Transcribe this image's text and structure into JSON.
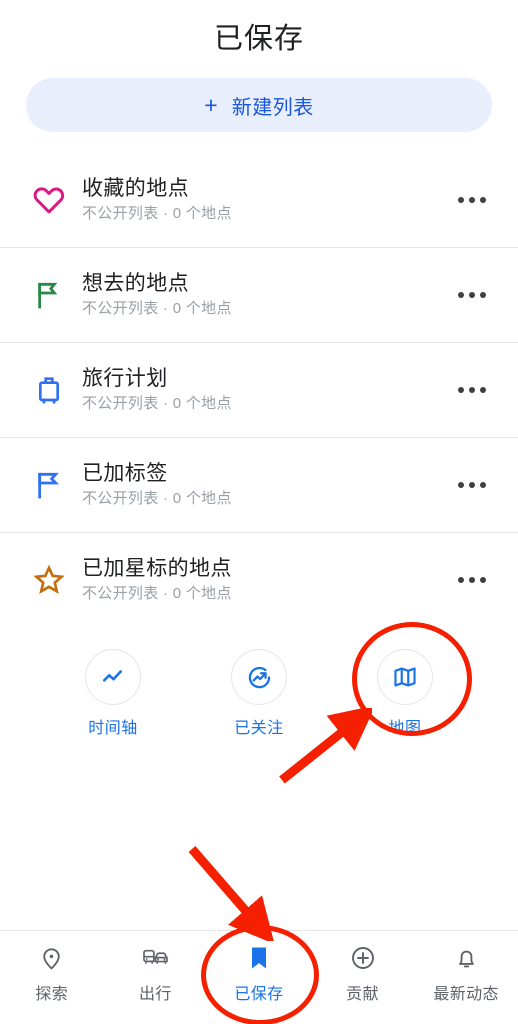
{
  "header": {
    "title": "已保存"
  },
  "new_list_button": {
    "icon": "plus-icon",
    "plus": "+",
    "label": "新建列表"
  },
  "saved_lists": [
    {
      "icon": "heart-icon",
      "icon_color": "#d81b82",
      "title": "收藏的地点",
      "subtitle": "不公开列表 · 0 个地点",
      "more": "more-options-icon"
    },
    {
      "icon": "flag-icon",
      "icon_color": "#288846",
      "title": "想去的地点",
      "subtitle": "不公开列表 · 0 个地点",
      "more": "more-options-icon"
    },
    {
      "icon": "suitcase-icon",
      "icon_color": "#2f71f0",
      "title": "旅行计划",
      "subtitle": "不公开列表 · 0 个地点",
      "more": "more-options-icon"
    },
    {
      "icon": "flag-icon",
      "icon_color": "#2f71f0",
      "title": "已加标签",
      "subtitle": "不公开列表 · 0 个地点",
      "more": "more-options-icon"
    },
    {
      "icon": "star-icon",
      "icon_color": "#c2700f",
      "title": "已加星标的地点",
      "subtitle": "不公开列表 · 0 个地点",
      "more": "more-options-icon"
    }
  ],
  "quick_actions": [
    {
      "icon": "timeline-chart-icon",
      "label": "时间轴"
    },
    {
      "icon": "trending-up-circle-icon",
      "label": "已关注"
    },
    {
      "icon": "map-icon",
      "label": "地图"
    }
  ],
  "bottom_nav": [
    {
      "icon": "location-pin-icon",
      "label": "探索",
      "active": false
    },
    {
      "icon": "transit-icon",
      "label": "出行",
      "active": false
    },
    {
      "icon": "bookmark-icon",
      "label": "已保存",
      "active": true
    },
    {
      "icon": "plus-circle-icon",
      "label": "贡献",
      "active": false
    },
    {
      "icon": "bell-icon",
      "label": "最新动态",
      "active": false
    }
  ],
  "annotations": {
    "highlight_color": "#f42000",
    "circles": [
      "map-quick-action",
      "saved-nav-item"
    ],
    "arrows": [
      "arrow-to-map-quick-action",
      "arrow-to-saved-nav-item"
    ]
  },
  "colors": {
    "accent_blue": "#1a73e8",
    "pill_bg": "#e8eefc",
    "pill_text": "#1a56db",
    "title_text": "#202124",
    "subtitle_text": "#9aa0a6",
    "nav_inactive": "#5f6368",
    "annotation_red": "#f42000"
  }
}
